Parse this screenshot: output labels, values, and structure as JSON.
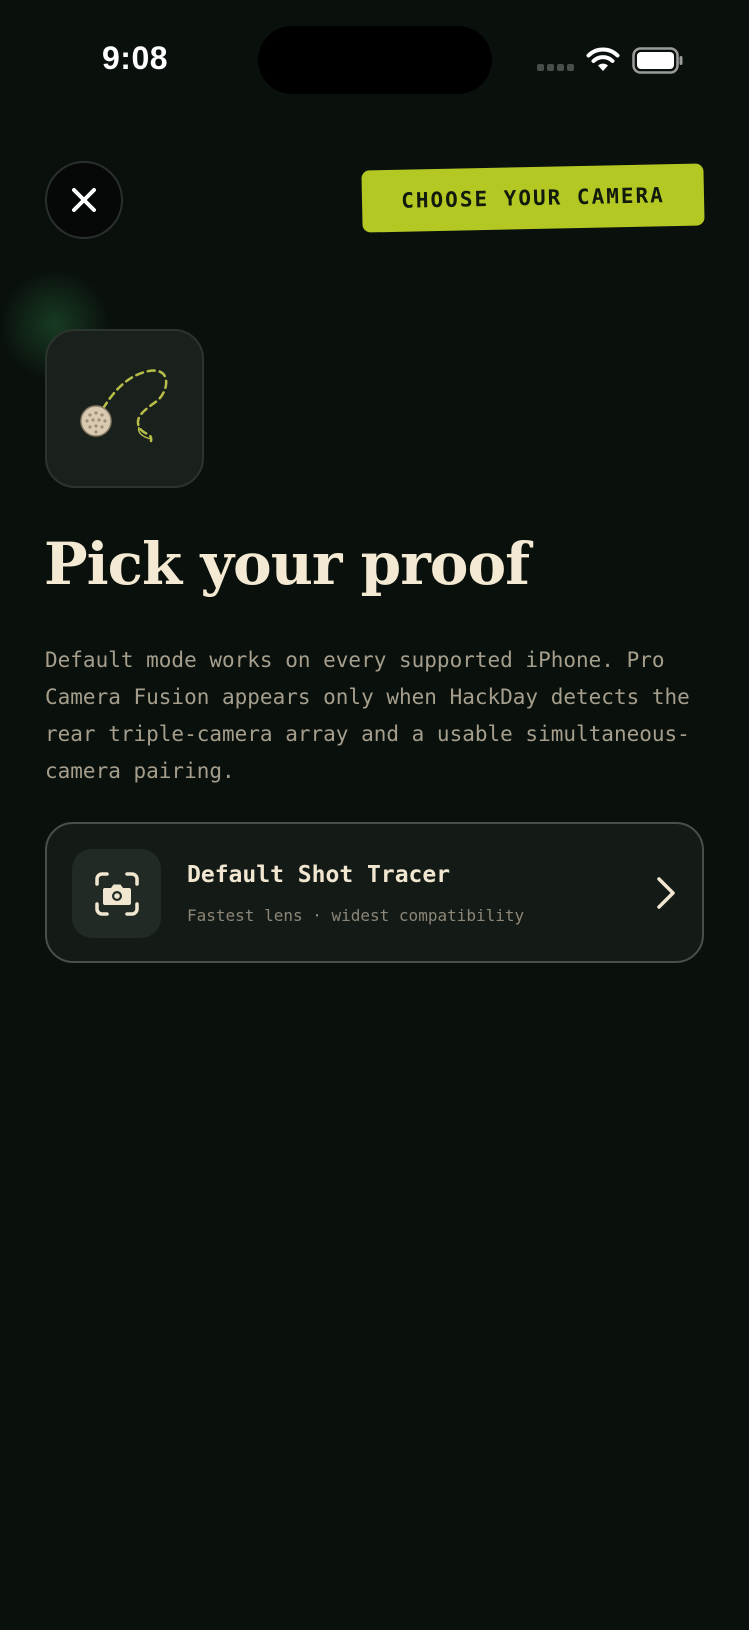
{
  "status_bar": {
    "time": "9:08"
  },
  "header": {
    "close_icon": "close-icon",
    "badge_label": "CHOOSE YOUR CAMERA"
  },
  "hero": {
    "icon": "golf-ball-trace-icon",
    "title": "Pick your proof",
    "description": "Default mode works on every supported iPhone. Pro Camera Fusion appears only when HackDay detects the rear triple-camera array and a usable simultaneous-camera pairing."
  },
  "options": [
    {
      "icon": "camera-scan-icon",
      "title": "Default Shot Tracer",
      "subtitle": "Fastest lens · widest compatibility",
      "chevron": "chevron-right-icon"
    }
  ],
  "colors": {
    "background": "#0a110d",
    "accent": "#b4c824",
    "text_primary": "#f1e6d0",
    "text_secondary": "#a69e8c"
  }
}
